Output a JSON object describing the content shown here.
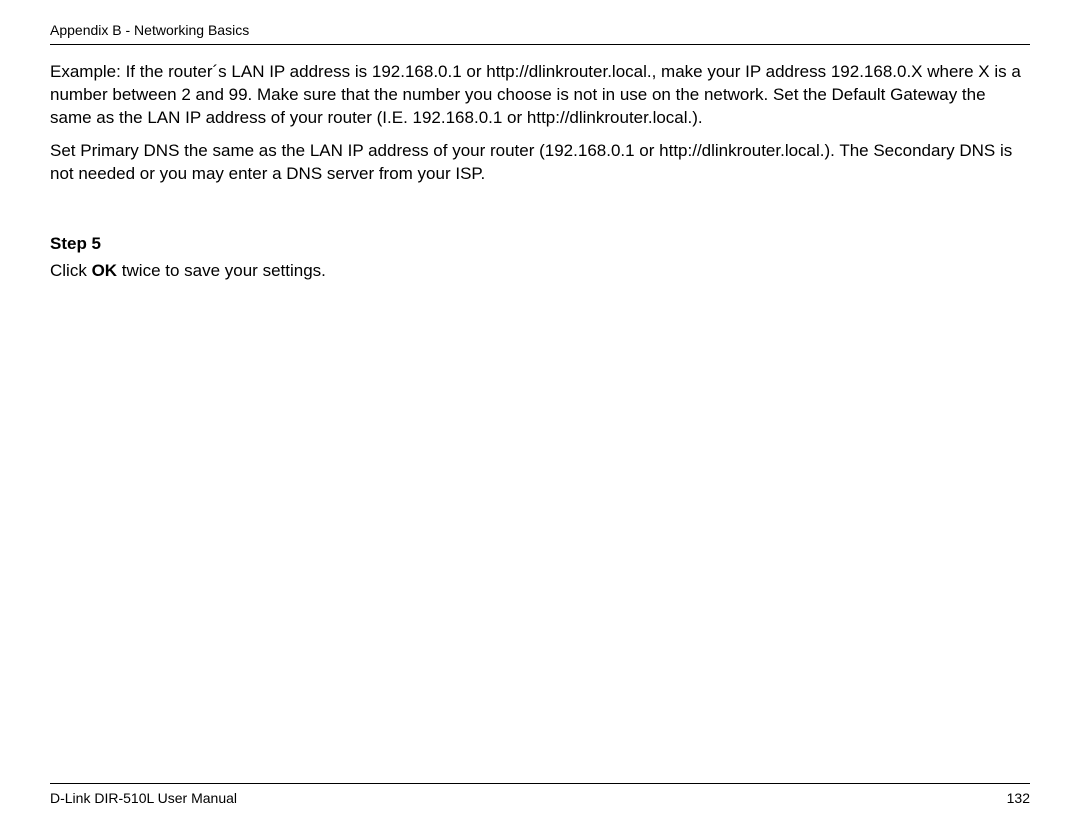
{
  "header": {
    "title": "Appendix B - Networking Basics"
  },
  "content": {
    "paragraph1": "Example: If the router´s LAN IP address is 192.168.0.1 or http://dlinkrouter.local., make your IP address 192.168.0.X where X is a number between 2 and 99. Make sure that the number you choose is not in use on the network. Set the Default Gateway the same as the LAN IP address of your router (I.E. 192.168.0.1 or http://dlinkrouter.local.).",
    "paragraph2": "Set Primary DNS the same as the LAN IP address of your router (192.168.0.1 or http://dlinkrouter.local.). The Secondary DNS is not needed or you may enter a DNS server from your ISP.",
    "step": {
      "heading": "Step 5",
      "prefix": "Click ",
      "bold": "OK",
      "suffix": " twice to save your settings."
    }
  },
  "footer": {
    "manual": "D-Link DIR-510L User Manual",
    "page": "132"
  }
}
